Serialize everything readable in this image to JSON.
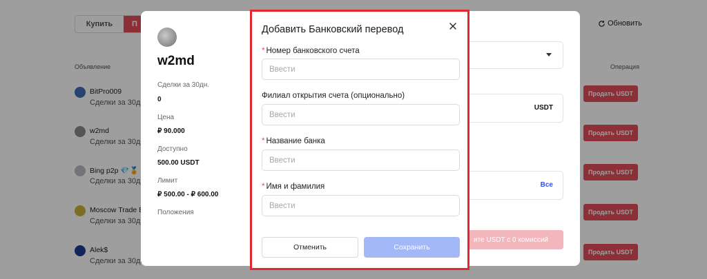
{
  "background": {
    "tabs": {
      "buy": "Купить",
      "sell": "П"
    },
    "refresh_label": "Обновить",
    "columns": {
      "ad": "Объявление",
      "operation": "Операция"
    },
    "rows": [
      {
        "name": "BitPro009",
        "deals": "Сделки за 30дн.",
        "button": "Продать USDT"
      },
      {
        "name": "w2md",
        "deals": "Сделки за 30дн.",
        "button": "Продать USDT"
      },
      {
        "name": "Bing p2p 💎🏅",
        "deals": "Сделки за 30дн.",
        "button": "Продать USDT"
      },
      {
        "name": "Moscow Trade E",
        "deals": "Сделки за 30дн.",
        "button": "Продать USDT"
      },
      {
        "name": "Alek$",
        "deals": "Сделки за 30дн.",
        "button": "Продать USDT"
      }
    ]
  },
  "merchant": {
    "name": "w2md",
    "deals_label": "Сделки за 30дн.",
    "deals_value": "0",
    "price_label": "Цена",
    "price_value": "₽ 90.000",
    "available_label": "Доступно",
    "available_value": "500.00 USDT",
    "limit_label": "Лимит",
    "limit_value": "₽ 500.00 - ₽ 600.00",
    "terms_label": "Положения",
    "amount_currency": "USDT",
    "all_label": "Все",
    "cta_partial": "ите USDT с 0 комиссий"
  },
  "modal": {
    "title": "Добавить Банковский перевод",
    "fields": [
      {
        "label": "Номер банковского счета",
        "required": true,
        "placeholder": "Ввести",
        "value": ""
      },
      {
        "label": "Филиал открытия счета (опционально)",
        "required": false,
        "placeholder": "Ввести",
        "value": ""
      },
      {
        "label": "Название банка",
        "required": true,
        "placeholder": "Ввести",
        "value": ""
      },
      {
        "label": "Имя и фамилия",
        "required": true,
        "placeholder": "Ввести",
        "value": ""
      }
    ],
    "cancel_label": "Отменить",
    "save_label": "Сохранить",
    "required_mark": "*"
  },
  "colors": {
    "accent_red": "#e34d59",
    "highlight_border": "#e6262e",
    "save_disabled": "#a3b9f7",
    "link_blue": "#2f54eb"
  }
}
